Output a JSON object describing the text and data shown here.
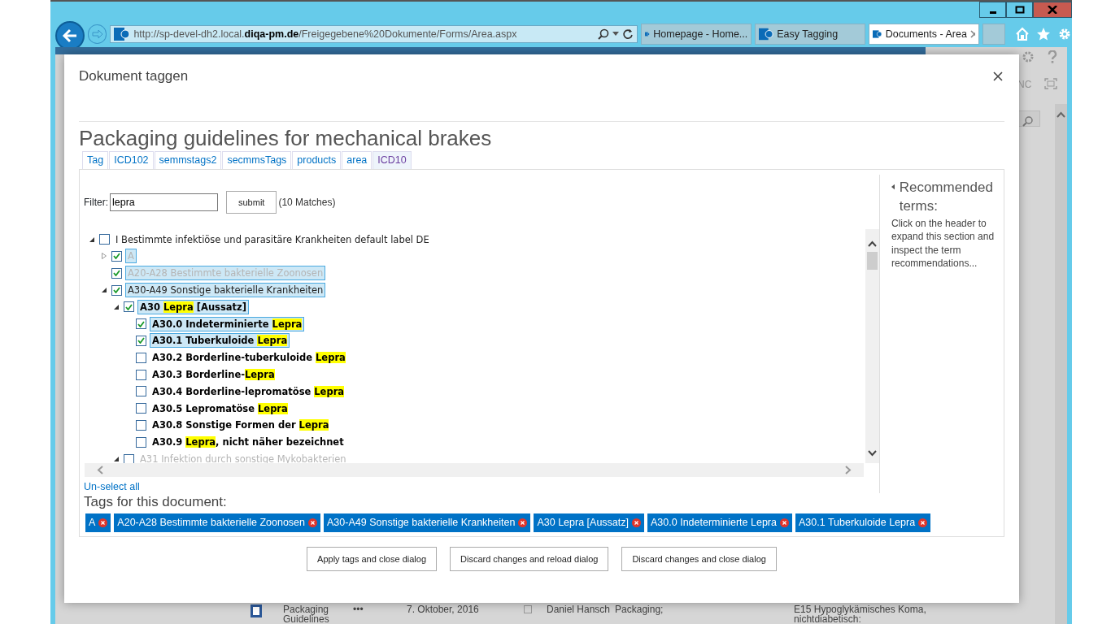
{
  "browser": {
    "address": "http://sp-devel-dh2.local.**diqa-pm.de**/Freigegebene%20Dokumente/Forms/Area.aspx",
    "tabs": [
      {
        "title": "Homepage - Home...",
        "selected": false
      },
      {
        "title": "Easy Tagging",
        "selected": false
      },
      {
        "title": "Documents - Area",
        "selected": true
      }
    ]
  },
  "page": {
    "header_text": "NC",
    "row": {
      "name": "Packaging Guidelines",
      "more": "•••",
      "date": "7. Oktober, 2016",
      "checked": false,
      "author": "Daniel Hansch",
      "tags": "Packaging;",
      "term": "E15 Hypoglykämisches Koma, nichtdiabetisch:"
    }
  },
  "dialog": {
    "title": "Dokument taggen",
    "heading": "Packaging guidelines for mechanical brakes",
    "tabs": [
      {
        "label": "Tag",
        "selected": false
      },
      {
        "label": "ICD102",
        "selected": false
      },
      {
        "label": "semmstags2",
        "selected": false
      },
      {
        "label": "secmmsTags",
        "selected": false
      },
      {
        "label": "products",
        "selected": false
      },
      {
        "label": "area",
        "selected": false
      },
      {
        "label": "ICD10",
        "selected": true
      }
    ],
    "filter": {
      "label": "Filter:",
      "value": "lepra",
      "button": "submit",
      "matches": "(10 Matches)"
    },
    "tree": [
      {
        "parts": [
          {
            "text": "I Bestimmte infektiöse und parasitäre Krankheiten default label DE"
          }
        ],
        "expanded": true,
        "checked": false,
        "selected": false,
        "dimmed": false,
        "bold": false,
        "children": [
          {
            "parts": [
              {
                "text": "A"
              }
            ],
            "expanded": false,
            "checked": true,
            "selected": true,
            "dimmed": true,
            "bold": false
          },
          {
            "parts": [
              {
                "text": "A20-A28 Bestimmte bakterielle Zoonosen"
              }
            ],
            "checked": true,
            "selected": true,
            "dimmed": true,
            "bold": false
          },
          {
            "parts": [
              {
                "text": "A30-A49 Sonstige bakterielle Krankheiten"
              }
            ],
            "expanded": true,
            "checked": true,
            "selected": true,
            "dimmed": false,
            "bold": false,
            "children": [
              {
                "parts": [
                  {
                    "text": "A30 "
                  },
                  {
                    "text": "Lepra",
                    "match": true
                  },
                  {
                    "text": " [Aussatz]"
                  }
                ],
                "expanded": true,
                "checked": true,
                "selected": true,
                "dimmed": false,
                "bold": true,
                "children": [
                  {
                    "parts": [
                      {
                        "text": "A30.0 Indeterminierte "
                      },
                      {
                        "text": "Lepra",
                        "match": true
                      }
                    ],
                    "checked": true,
                    "selected": true,
                    "dimmed": false,
                    "bold": true
                  },
                  {
                    "parts": [
                      {
                        "text": "A30.1 Tuberkuloide "
                      },
                      {
                        "text": "Lepra",
                        "match": true
                      }
                    ],
                    "checked": true,
                    "selected": true,
                    "dimmed": false,
                    "bold": true
                  },
                  {
                    "parts": [
                      {
                        "text": "A30.2 Borderline-tuberkuloide "
                      },
                      {
                        "text": "Lepra",
                        "match": true
                      }
                    ],
                    "checked": false,
                    "selected": false,
                    "dimmed": false,
                    "bold": true
                  },
                  {
                    "parts": [
                      {
                        "text": "A30.3 Borderline-"
                      },
                      {
                        "text": "Lepra",
                        "match": true
                      }
                    ],
                    "checked": false,
                    "selected": false,
                    "dimmed": false,
                    "bold": true
                  },
                  {
                    "parts": [
                      {
                        "text": "A30.4 Borderline-lepromatöse "
                      },
                      {
                        "text": "Lepra",
                        "match": true
                      }
                    ],
                    "checked": false,
                    "selected": false,
                    "dimmed": false,
                    "bold": true
                  },
                  {
                    "parts": [
                      {
                        "text": "A30.5 Lepromatöse "
                      },
                      {
                        "text": "Lepra",
                        "match": true
                      }
                    ],
                    "checked": false,
                    "selected": false,
                    "dimmed": false,
                    "bold": true
                  },
                  {
                    "parts": [
                      {
                        "text": "A30.8 Sonstige Formen der "
                      },
                      {
                        "text": "Lepra",
                        "match": true
                      }
                    ],
                    "checked": false,
                    "selected": false,
                    "dimmed": false,
                    "bold": true
                  },
                  {
                    "parts": [
                      {
                        "text": "A30.9 "
                      },
                      {
                        "text": "Lepra",
                        "match": true
                      },
                      {
                        "text": ", nicht näher bezeichnet"
                      }
                    ],
                    "checked": false,
                    "selected": false,
                    "dimmed": false,
                    "bold": true
                  }
                ]
              },
              {
                "parts": [
                  {
                    "text": "A31 Infektion durch sonstige Mykobakterien"
                  }
                ],
                "expanded": true,
                "checked": false,
                "selected": false,
                "dimmed": true,
                "bold": false
              }
            ]
          }
        ]
      }
    ],
    "unselect": "Un-select all",
    "recommended": {
      "title": "Recommended terms:",
      "text": "Click on the header to expand this section and inspect the term recommendations..."
    },
    "tags_label": "Tags for this document:",
    "tags": [
      "A",
      "A20-A28 Bestimmte bakterielle Zoonosen",
      "A30-A49 Sonstige bakterielle Krankheiten",
      "A30 Lepra [Aussatz]",
      "A30.0 Indeterminierte Lepra",
      "A30.1 Tuberkuloide Lepra"
    ],
    "buttons": [
      "Apply tags and close dialog",
      "Discard changes and reload dialog",
      "Discard changes and close dialog"
    ]
  }
}
